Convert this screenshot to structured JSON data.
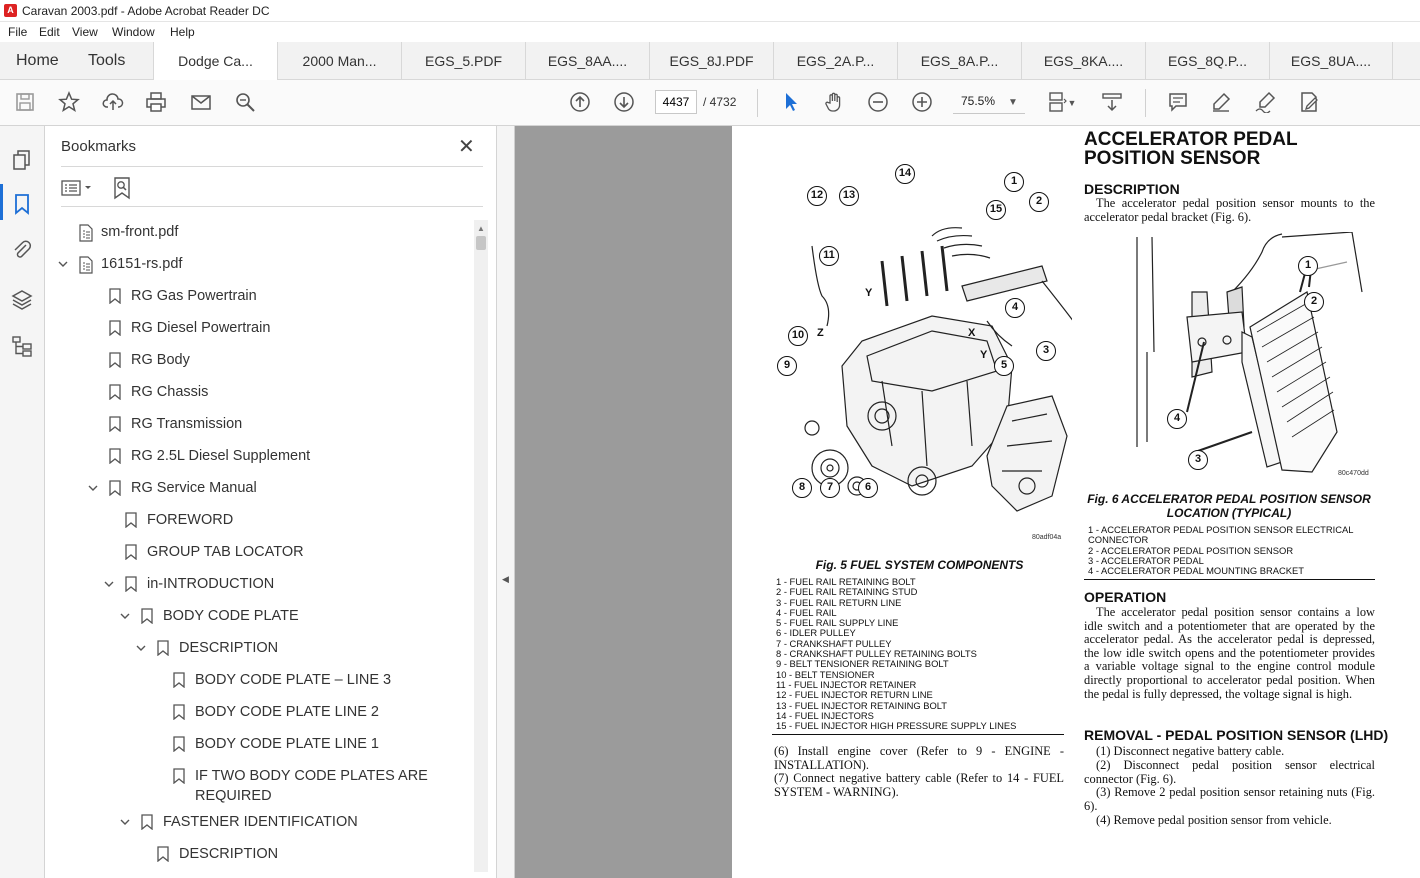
{
  "window": {
    "title": "Caravan 2003.pdf - Adobe Acrobat Reader DC"
  },
  "menu": [
    "File",
    "Edit",
    "View",
    "Window",
    "Help"
  ],
  "nav": {
    "home": "Home",
    "tools": "Tools"
  },
  "tabs": [
    "Dodge Ca...",
    "2000 Man...",
    "EGS_5.PDF",
    "EGS_8AA....",
    "EGS_8J.PDF",
    "EGS_2A.P...",
    "EGS_8A.P...",
    "EGS_8KA....",
    "EGS_8Q.P...",
    "EGS_8UA...."
  ],
  "toolbar": {
    "page_current": "4437",
    "page_total": "/ 4732",
    "zoom": "75.5%"
  },
  "bookmarks": {
    "title": "Bookmarks",
    "items": [
      {
        "label": "sm-front.pdf",
        "level": 0,
        "type": "file"
      },
      {
        "label": "16151-rs.pdf",
        "level": 0,
        "type": "file",
        "expanded": true
      },
      {
        "label": "RG Gas Powertrain",
        "level": 1
      },
      {
        "label": "RG Diesel Powertrain",
        "level": 1
      },
      {
        "label": "RG Body",
        "level": 1
      },
      {
        "label": "RG Chassis",
        "level": 1
      },
      {
        "label": "RG Transmission",
        "level": 1
      },
      {
        "label": "RG 2.5L Diesel Supplement",
        "level": 1
      },
      {
        "label": "RG Service Manual",
        "level": 1,
        "expanded": true
      },
      {
        "label": "FOREWORD",
        "level": 2
      },
      {
        "label": "GROUP TAB LOCATOR",
        "level": 2
      },
      {
        "label": "in-INTRODUCTION",
        "level": 2,
        "expanded": true
      },
      {
        "label": "BODY CODE PLATE",
        "level": 3,
        "expanded": true
      },
      {
        "label": "DESCRIPTION",
        "level": 4,
        "expanded": true
      },
      {
        "label": "BODY CODE PLATE – LINE 3",
        "level": 5
      },
      {
        "label": "BODY CODE PLATE LINE 2",
        "level": 5
      },
      {
        "label": "BODY CODE PLATE LINE 1",
        "level": 5
      },
      {
        "label": "IF TWO BODY CODE PLATES ARE",
        "label2": "REQUIRED",
        "level": 5
      },
      {
        "label": "FASTENER IDENTIFICATION",
        "level": 3,
        "expanded": true
      },
      {
        "label": "DESCRIPTION",
        "level": 4
      }
    ]
  },
  "document": {
    "fig5": {
      "callouts": [
        "1",
        "2",
        "3",
        "4",
        "5",
        "6",
        "7",
        "8",
        "9",
        "10",
        "11",
        "12",
        "13",
        "14",
        "15"
      ],
      "axis_letters": [
        "Y",
        "Z",
        "X",
        "Y"
      ],
      "code": "80adf04a",
      "caption": "Fig. 5 FUEL SYSTEM COMPONENTS",
      "legend": [
        "1 - FUEL RAIL RETAINING BOLT",
        "2 - FUEL RAIL RETAINING STUD",
        "3 - FUEL RAIL RETURN LINE",
        "4 - FUEL RAIL",
        "5 - FUEL RAIL SUPPLY LINE",
        "6 - IDLER PULLEY",
        "7 - CRANKSHAFT PULLEY",
        "8 - CRANKSHAFT PULLEY RETAINING BOLTS",
        "9 - BELT TENSIONER RETAINING BOLT",
        "10 - BELT TENSIONER",
        "11 - FUEL INJECTOR RETAINER",
        "12 - FUEL INJECTOR RETURN LINE",
        "13 - FUEL INJECTOR RETAINING BOLT",
        "14 - FUEL INJECTORS",
        "15 - FUEL INJECTOR HIGH PRESSURE SUPPLY LINES"
      ]
    },
    "left_steps": [
      "(6) Install engine cover (Refer to 9 - ENGINE - INSTALLATION).",
      "(7) Connect negative battery cable (Refer to 14 - FUEL SYSTEM - WARNING)."
    ],
    "heading": "ACCELERATOR PEDAL POSITION SENSOR",
    "description_title": "DESCRIPTION",
    "description_text": "The accelerator pedal position sensor mounts to the accelerator pedal bracket (Fig. 6).",
    "fig6": {
      "callouts": [
        "1",
        "2",
        "3",
        "4"
      ],
      "code": "80c470dd",
      "caption": "Fig. 6 ACCELERATOR PEDAL POSITION SENSOR LOCATION (TYPICAL)",
      "legend": [
        "1 - ACCELERATOR PEDAL POSITION SENSOR ELECTRICAL CONNECTOR",
        "2 - ACCELERATOR PEDAL POSITION SENSOR",
        "3 - ACCELERATOR PEDAL",
        "4 - ACCELERATOR PEDAL MOUNTING BRACKET"
      ]
    },
    "operation_title": "OPERATION",
    "operation_text": "The accelerator pedal position sensor contains a low idle switch and a potentiometer that are operated by the accelerator pedal. As the accelerator pedal is depressed, the low idle switch opens and the potentiometer provides a variable voltage signal to the engine control module directly proportional to accelerator pedal position. When the pedal is fully depressed, the voltage signal is high.",
    "removal_title": "REMOVAL - PEDAL POSITION SENSOR (LHD)",
    "removal_steps": [
      "(1) Disconnect negative battery cable.",
      "(2) Disconnect pedal position sensor electrical connector (Fig. 6).",
      "(3) Remove 2 pedal position sensor retaining nuts (Fig. 6).",
      "(4) Remove pedal position sensor from vehicle."
    ]
  }
}
